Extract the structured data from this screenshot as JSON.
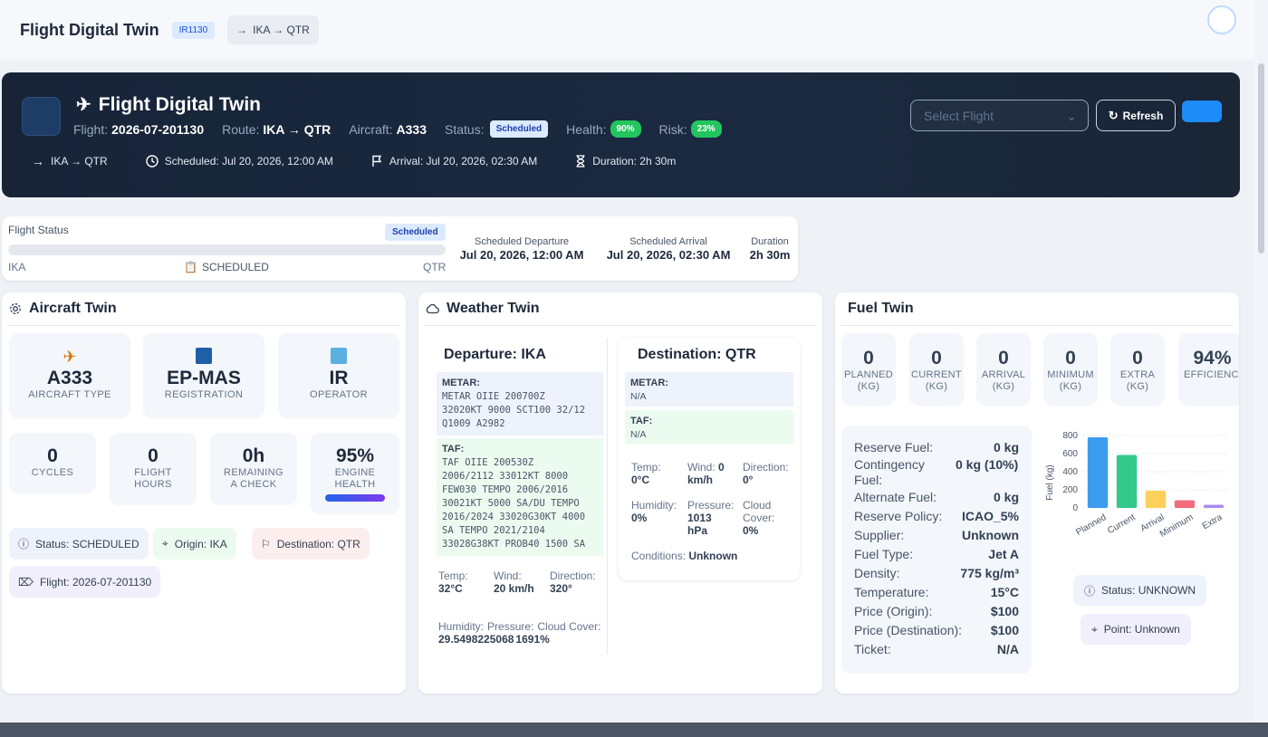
{
  "topbar": {
    "title": "Flight Digital Twin",
    "badge": "IR1130",
    "route": "IKA → QTR"
  },
  "hero": {
    "title": "Flight Digital Twin",
    "flight_label": "Flight:",
    "flight_value": "2026-07-201130",
    "route_label": "Route:",
    "route_value": "IKA → QTR",
    "aircraft_label": "Aircraft:",
    "aircraft_value": "A333",
    "status_label": "Status:",
    "status_value": "Scheduled",
    "health_label": "Health:",
    "health_value": "90%",
    "risk_label": "Risk:",
    "risk_value": "23%",
    "route_sub": "IKA → QTR",
    "scheduled": "Scheduled: Jul 20, 2026, 12:00 AM",
    "arrival": "Arrival: Jul 20, 2026, 02:30 AM",
    "duration": "Duration: 2h 30m",
    "select_placeholder": "Select Flight",
    "refresh_label": "Refresh"
  },
  "status_card": {
    "label": "Flight Status",
    "badge": "Scheduled",
    "origin": "IKA",
    "state": "SCHEDULED",
    "destination": "QTR",
    "progress_percent": 0,
    "sched_dep_label": "Scheduled Departure",
    "sched_dep_value": "Jul 20, 2026, 12:00 AM",
    "sched_arr_label": "Scheduled Arrival",
    "sched_arr_value": "Jul 20, 2026, 02:30 AM",
    "duration_label": "Duration",
    "duration_value": "2h 30m"
  },
  "aircraft": {
    "title": "Aircraft Twin",
    "tiles": [
      {
        "value": "A333",
        "caption": "AIRCRAFT TYPE"
      },
      {
        "value": "EP-MAS",
        "caption": "REGISTRATION"
      },
      {
        "value": "IR",
        "caption": "OPERATOR"
      }
    ],
    "stats": [
      {
        "value": "0",
        "caption1": "CYCLES",
        "caption2": ""
      },
      {
        "value": "0",
        "caption1": "FLIGHT",
        "caption2": "HOURS"
      },
      {
        "value": "0h",
        "caption1": "REMAINING",
        "caption2": "A CHECK"
      },
      {
        "value": "95%",
        "caption1": "ENGINE",
        "caption2": "HEALTH"
      }
    ],
    "engine_health_fraction": 0.95,
    "chips": {
      "status": "Status: SCHEDULED",
      "origin": "Origin: IKA",
      "destination": "Destination: QTR",
      "flight": "Flight: 2026-07-201130"
    }
  },
  "weather": {
    "title": "Weather Twin",
    "departure": {
      "title": "Departure: IKA",
      "metar_label": "METAR:",
      "metar_lines": [
        "METAR OIIE 200700Z",
        "32020KT 9000 SCT100 32/12",
        "Q1009 A2982"
      ],
      "taf_label": "TAF:",
      "taf_lines": [
        "TAF OIIE 200530Z",
        "2006/2112 33012KT 8000",
        "FEW030 TEMPO 2006/2016",
        "30021KT 5000 SA/DU TEMPO",
        "2016/2024 33020G30KT 4000",
        "SA TEMPO 2021/2104",
        "33028G38KT PROB40 1500 SA"
      ],
      "temp_label": "Temp:",
      "temp_value": "32°C",
      "wind_label": "Wind:",
      "wind_value": "20 km/h",
      "dir_label": "Direction:",
      "dir_value": "320°",
      "hum_label": "Humidity:",
      "hum_value": "29.5498225068",
      "press_label": "Pressure:",
      "press_value": "1691%",
      "cloud_label": "Cloud Cover:"
    },
    "destination": {
      "title": "Destination: QTR",
      "metar_label": "METAR:",
      "metar_value": "N/A",
      "taf_label": "TAF:",
      "taf_value": "N/A",
      "temp_label": "Temp:",
      "temp_value": "0°C",
      "wind_label": "Wind:",
      "wind_value": "0",
      "wind_unit": "km/h",
      "dir_label": "Direction:",
      "dir_value": "0°",
      "hum_label": "Humidity:",
      "hum_value": "0%",
      "press_label": "Pressure:",
      "press_value": "1013",
      "press_unit": "hPa",
      "cloud_label": "Cloud",
      "cloud_label2": "Cover:",
      "cloud_value": "0%",
      "conditions_label": "Conditions:",
      "conditions_value": "Unknown"
    }
  },
  "fuel": {
    "title": "Fuel Twin",
    "tiles": [
      {
        "value": "0",
        "cap1": "PLANNED",
        "cap2": "(KG)"
      },
      {
        "value": "0",
        "cap1": "CURRENT",
        "cap2": "(KG)"
      },
      {
        "value": "0",
        "cap1": "ARRIVAL",
        "cap2": "(KG)"
      },
      {
        "value": "0",
        "cap1": "MINIMUM",
        "cap2": "(KG)"
      },
      {
        "value": "0",
        "cap1": "EXTRA",
        "cap2": "(KG)"
      },
      {
        "value": "94%",
        "cap1": "EFFICIENC",
        "cap2": ""
      }
    ],
    "details": [
      {
        "label": "Reserve Fuel:",
        "value": "0 kg"
      },
      {
        "label": "Contingency Fuel:",
        "value": "0 kg (10%)"
      },
      {
        "label": "Alternate Fuel:",
        "value": "0 kg"
      },
      {
        "label": "Reserve Policy:",
        "value": "ICAO_5%"
      },
      {
        "label": "Supplier:",
        "value": "Unknown"
      },
      {
        "label": "Fuel Type:",
        "value": "Jet A"
      },
      {
        "label": "Density:",
        "value": "775 kg/m³"
      },
      {
        "label": "Temperature:",
        "value": "15°C"
      },
      {
        "label": "Price (Origin):",
        "value": "$100"
      },
      {
        "label": "Price (Destination):",
        "value": "$100"
      },
      {
        "label": "Ticket:",
        "value": "N/A"
      }
    ],
    "status_chip": "Status: UNKNOWN",
    "point_chip": "Point: Unknown"
  },
  "chart_data": {
    "type": "bar",
    "categories": [
      "Planned",
      "Current",
      "Arrival",
      "Minimum",
      "Extra"
    ],
    "values": [
      780,
      585,
      190,
      85,
      35
    ],
    "colors": [
      "#3b9cf0",
      "#34c98a",
      "#fcd05a",
      "#f36b7a",
      "#a98bf0"
    ],
    "ylabel": "Fuel (kg)",
    "yticks": [
      0,
      200,
      400,
      600,
      800
    ],
    "ylim": [
      0,
      800
    ],
    "grid": true
  }
}
